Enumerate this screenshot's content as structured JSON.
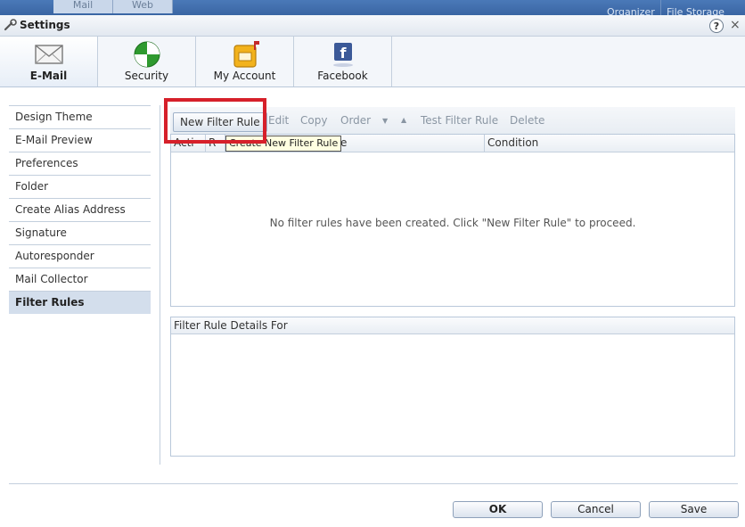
{
  "top_tabs": {
    "mail": "Mail",
    "web": "Web"
  },
  "top_right": {
    "organizer": "Organizer",
    "file_storage": "File Storage"
  },
  "window": {
    "title": "Settings",
    "help": "?",
    "close": "×"
  },
  "category_tabs": [
    {
      "label": "E-Mail",
      "icon": "envelope-icon",
      "active": true
    },
    {
      "label": "Security",
      "icon": "shield-icon",
      "active": false
    },
    {
      "label": "My Account",
      "icon": "mailbox-icon",
      "active": false
    },
    {
      "label": "Facebook",
      "icon": "facebook-icon",
      "active": false
    }
  ],
  "sidebar": {
    "items": [
      {
        "label": "Design Theme"
      },
      {
        "label": "E-Mail Preview"
      },
      {
        "label": "Preferences"
      },
      {
        "label": "Folder"
      },
      {
        "label": "Create Alias Address"
      },
      {
        "label": "Signature"
      },
      {
        "label": "Autoresponder"
      },
      {
        "label": "Mail Collector"
      },
      {
        "label": "Filter Rules",
        "selected": true
      }
    ]
  },
  "toolbar": {
    "new_filter_rule": "New Filter Rule",
    "edit": "Edit",
    "copy": "Copy",
    "order": "Order",
    "order_down": "▼",
    "order_up": "▲",
    "test_filter_rule": "Test Filter Rule",
    "delete": "Delete"
  },
  "grid": {
    "columns": [
      "Acti",
      "R",
      "Create New Filter Rule",
      "Condition"
    ],
    "empty_message": "No filter rules have been created. Click \"New Filter Rule\" to proceed.",
    "tooltip": "Create New Filter Rule"
  },
  "details": {
    "header": "Filter Rule Details For"
  },
  "footer": {
    "ok": "OK",
    "cancel": "Cancel",
    "save": "Save"
  },
  "colors": {
    "accent_blue": "#3a65a3",
    "highlight_red": "#d6202a",
    "selected_nav": "#d3deec"
  }
}
